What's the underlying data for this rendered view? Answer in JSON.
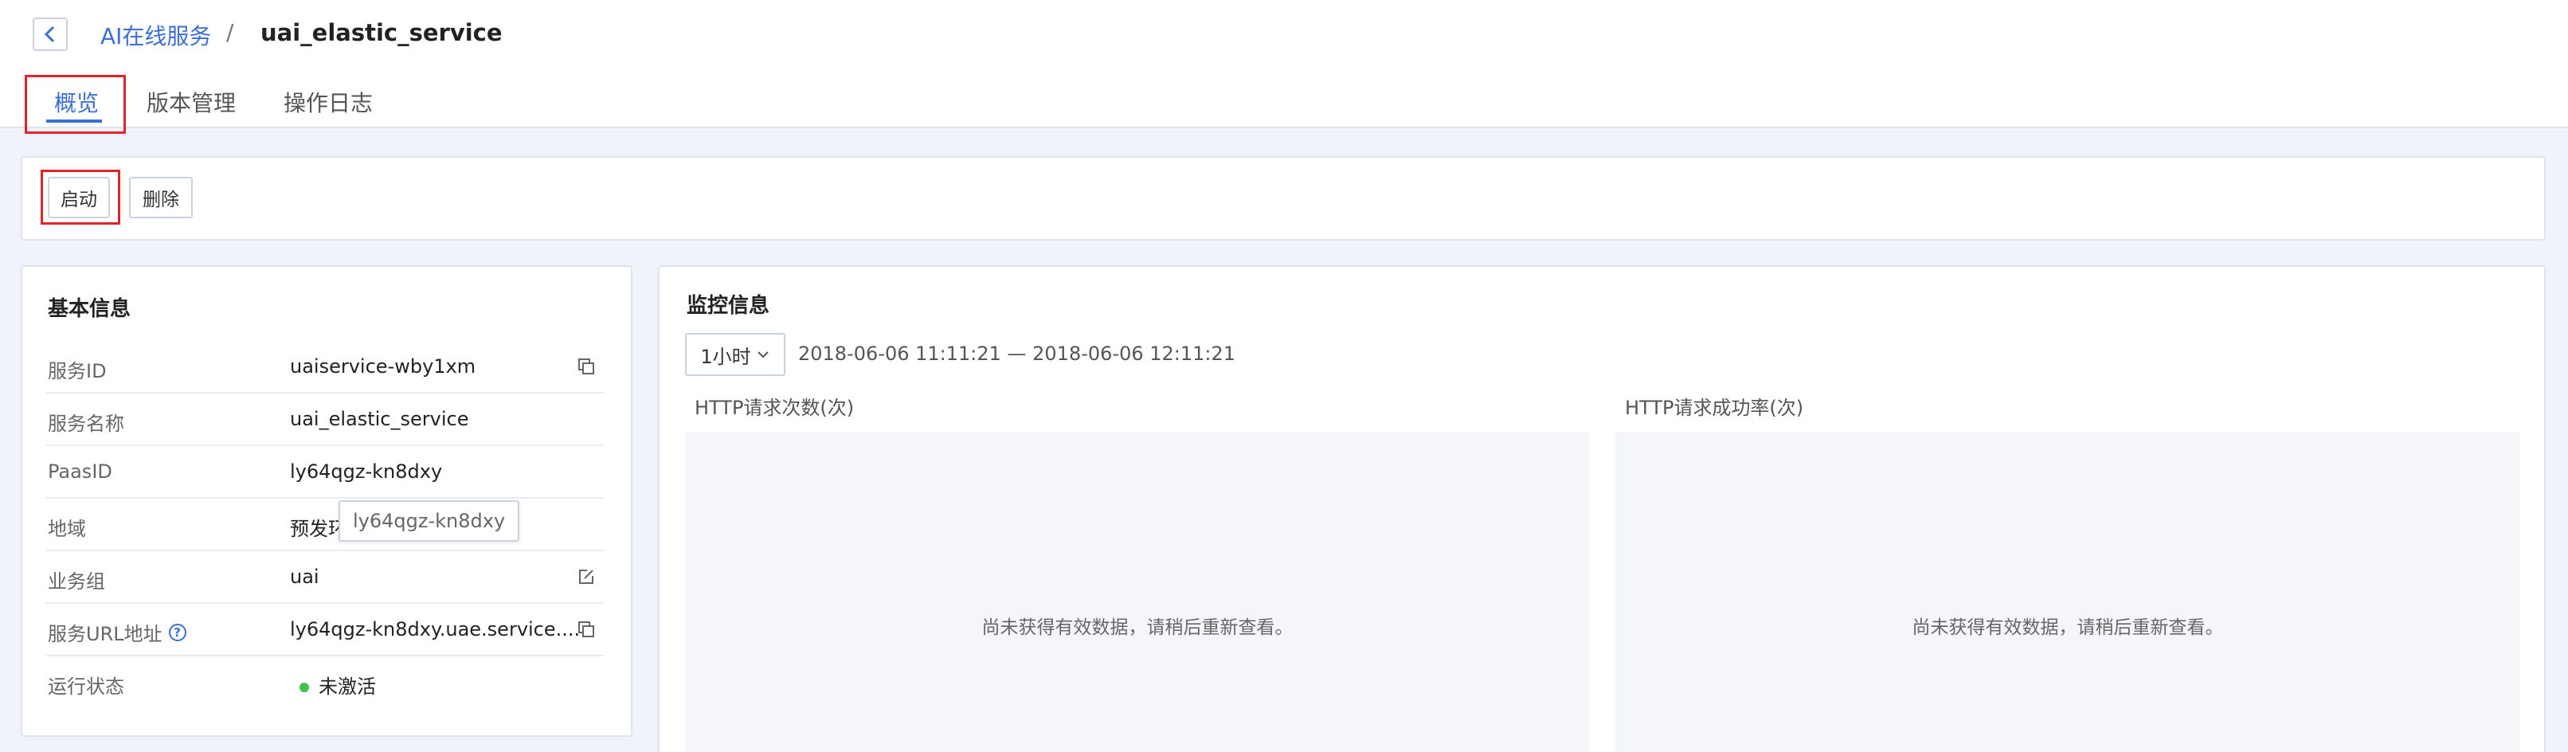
{
  "breadcrumb": {
    "parent": "AI在线服务",
    "separator": "/",
    "current": "uai_elastic_service"
  },
  "tabs": [
    {
      "label": "概览",
      "active": true
    },
    {
      "label": "版本管理",
      "active": false
    },
    {
      "label": "操作日志",
      "active": false
    }
  ],
  "toolbar": {
    "start_label": "启动",
    "delete_label": "删除"
  },
  "basic_info": {
    "title": "基本信息",
    "rows": [
      {
        "label": "服务ID",
        "value": "uaiservice-wby1xm",
        "icon": "copy-icon"
      },
      {
        "label": "服务名称",
        "value": "uai_elastic_service"
      },
      {
        "label": "PaasID",
        "value": "ly64qgz-kn8dxy"
      },
      {
        "label": "地域",
        "value": "预发环境"
      },
      {
        "label": "业务组",
        "value": "uai",
        "icon": "edit-icon"
      },
      {
        "label": "服务URL地址",
        "value": "ly64qgz-kn8dxy.uae.service....",
        "icon": "copy-icon",
        "help": "?"
      },
      {
        "label": "运行状态",
        "value": "未激活",
        "status_color": "#3fc14f"
      }
    ],
    "tooltip": "ly64qgz-kn8dxy"
  },
  "monitor": {
    "title": "监控信息",
    "range_value": "1小时",
    "time_range": "2018-06-06 11:11:21 — 2018-06-06 12:11:21",
    "charts": [
      {
        "label": "HTTP请求次数(次)",
        "empty_message": "尚未获得有效数据，请稍后重新查看。"
      },
      {
        "label": "HTTP请求成功率(次)",
        "empty_message": "尚未获得有效数据，请稍后重新查看。"
      }
    ]
  },
  "colors": {
    "accent": "#3c6fd6",
    "highlight_border": "#e0242b",
    "status_inactive_dot": "#3fc14f"
  }
}
